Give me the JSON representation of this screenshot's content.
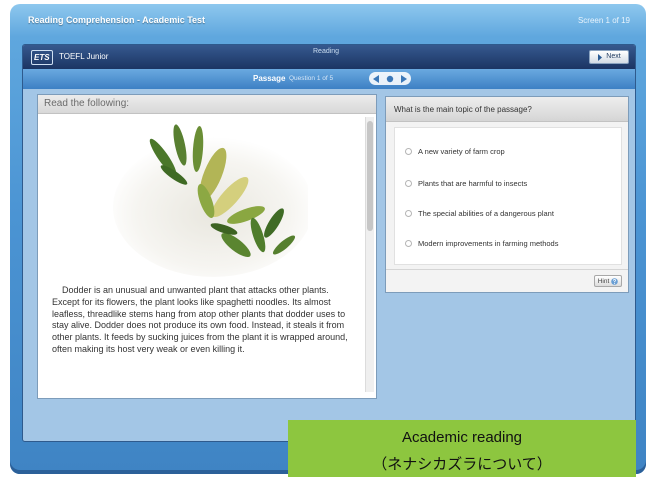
{
  "window": {
    "title": "Reading Comprehension - Academic Test",
    "screen_counter": "Screen 1 of 19"
  },
  "app_header": {
    "logo": "ETS",
    "product": "TOEFL Junior",
    "section": "Reading",
    "next_label": "Next"
  },
  "tabs": {
    "passage": "Passage",
    "progress": "Question 1 of 5"
  },
  "passage": {
    "heading": "Read the following:",
    "image_icon": "dodder-plant-image",
    "text": "Dodder is an unusual and unwanted plant that attacks other plants. Except for its flowers, the plant looks like spaghetti noodles. Its almost leafless, threadlike stems hang from atop other plants that dodder uses to stay alive. Dodder does not produce its own food. Instead, it steals it from other plants. It feeds by sucking juices from the plant it is wrapped around, often making its host very weak or even killing it."
  },
  "question": {
    "prompt": "What is the main topic of the passage?",
    "options": [
      "A new variety of farm crop",
      "Plants that are harmful to insects",
      "The special abilities of a dangerous plant",
      "Modern improvements in farming methods"
    ],
    "hint_label": "Hint"
  },
  "caption": {
    "line1": "Academic reading",
    "line2": "（ネナシカズラについて）"
  },
  "icons": {
    "next": "chevron-right-icon",
    "prev_nav": "arrow-left-icon",
    "next_nav": "arrow-right-icon",
    "hint": "question-icon"
  },
  "colors": {
    "frame_blue": "#4b94d3",
    "header_navy": "#1b3563",
    "caption_green": "#8dc63f"
  }
}
